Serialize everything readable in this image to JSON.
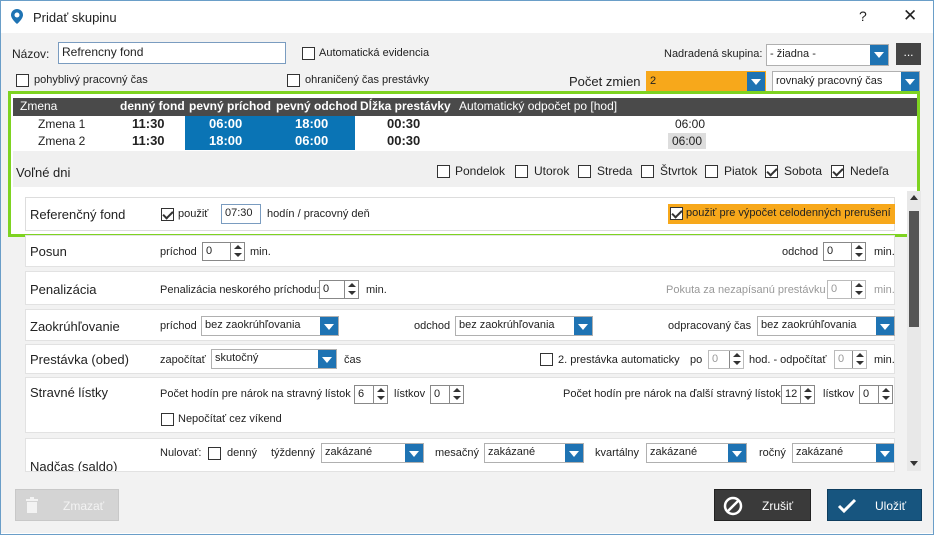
{
  "window": {
    "title": "Pridať skupinu",
    "help": "?",
    "close": "✕"
  },
  "form": {
    "name_label": "Názov:",
    "name_value": "Refrencny fond",
    "auto_evidence": "Automatická evidencia",
    "parent_label": "Nadradená skupina:",
    "parent_value": "- žiadna -",
    "more": "...",
    "flex_time": "pohyblivý pracovný čas",
    "limited_break": "ohraničený čas prestávky",
    "shift_count_label": "Počet zmien",
    "shift_count_value": "2",
    "work_time_value": "rovnaký pracovný čas"
  },
  "grid": {
    "headers": [
      "Zmena",
      "denný fond",
      "pevný príchod",
      "pevný odchod",
      "Dĺžka prestávky",
      "Automatický odpočet po [hod]"
    ],
    "rows": [
      {
        "name": "Zmena 1",
        "fond": "11:30",
        "arrival": "06:00",
        "departure": "18:00",
        "break": "00:30",
        "auto": "06:00"
      },
      {
        "name": "Zmena 2",
        "fond": "11:30",
        "arrival": "18:00",
        "departure": "06:00",
        "break": "00:30",
        "auto": "06:00"
      }
    ]
  },
  "free_days": {
    "label": "Voľné dni",
    "days": [
      {
        "name": "Pondelok",
        "checked": false
      },
      {
        "name": "Utorok",
        "checked": false
      },
      {
        "name": "Streda",
        "checked": false
      },
      {
        "name": "Štvrtok",
        "checked": false
      },
      {
        "name": "Piatok",
        "checked": false
      },
      {
        "name": "Sobota",
        "checked": true
      },
      {
        "name": "Nedeľa",
        "checked": true
      }
    ]
  },
  "ref_fund": {
    "title": "Referenčný fond",
    "use": "použiť",
    "hours": "07:30",
    "unit": "hodín / pracovný deň",
    "full_day": "použiť pre výpočet celodenných prerušení"
  },
  "posun": {
    "title": "Posun",
    "arrival": "príchod",
    "arrival_val": "0",
    "min": "min.",
    "departure": "odchod",
    "departure_val": "0"
  },
  "penal": {
    "title": "Penalizácia",
    "late": "Penalizácia neskorého príchodu:",
    "late_val": "0",
    "min": "min.",
    "fine": "Pokuta za nezapísanú prestávku",
    "fine_val": "0"
  },
  "round": {
    "title": "Zaokrúhľovanie",
    "arrival": "príchod",
    "departure": "odchod",
    "worked": "odpracovaný čas",
    "value": "bez zaokrúhľovania"
  },
  "break": {
    "title": "Prestávka (obed)",
    "count": "započítať",
    "count_val": "skutočný",
    "time": "čas",
    "second": "2. prestávka automaticky",
    "after": "po",
    "hours_val": "0",
    "hod": "hod. - odpočítať",
    "min_val": "0",
    "min": "min."
  },
  "meal": {
    "title": "Stravné lístky",
    "hours_for": "Počet hodín pre nárok na stravný lístok",
    "h1": "6",
    "tickets": "lístkov",
    "t1": "0",
    "hours_next": "Počet hodín pre nárok na ďalší stravný lístok",
    "h2": "12",
    "t2": "0",
    "no_weekend": "Nepočítať cez víkend"
  },
  "overtime": {
    "title": "Nadčas (saldo)",
    "reset": "Nulovať:",
    "daily": "denný",
    "weekly": "týždenný",
    "monthly": "mesačný",
    "quarterly": "kvartálny",
    "yearly": "ročný",
    "value": "zakázané"
  },
  "buttons": {
    "delete": "Zmazať",
    "cancel": "Zrušiť",
    "save": "Uložiť"
  },
  "colors": {
    "accent": "#1e73b3",
    "orange": "#f7a81b",
    "green": "#7ed321"
  }
}
